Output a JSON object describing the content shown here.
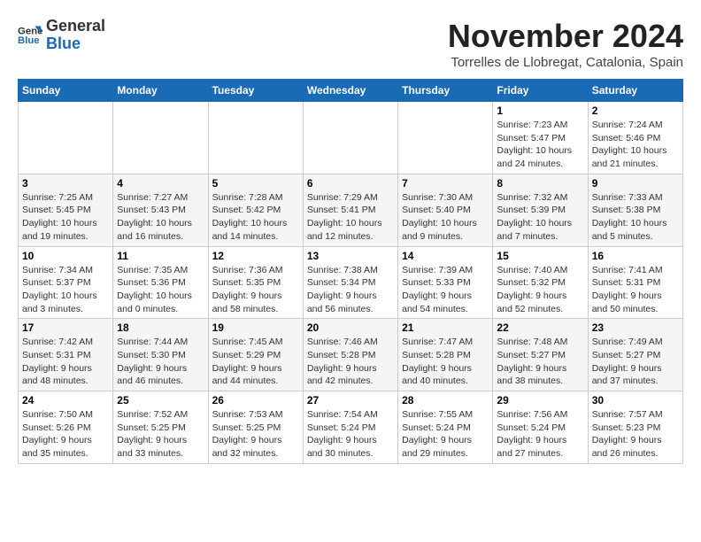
{
  "logo": {
    "general": "General",
    "blue": "Blue"
  },
  "header": {
    "month_title": "November 2024",
    "location": "Torrelles de Llobregat, Catalonia, Spain"
  },
  "weekdays": [
    "Sunday",
    "Monday",
    "Tuesday",
    "Wednesday",
    "Thursday",
    "Friday",
    "Saturday"
  ],
  "weeks": [
    [
      {
        "day": "",
        "info": ""
      },
      {
        "day": "",
        "info": ""
      },
      {
        "day": "",
        "info": ""
      },
      {
        "day": "",
        "info": ""
      },
      {
        "day": "",
        "info": ""
      },
      {
        "day": "1",
        "info": "Sunrise: 7:23 AM\nSunset: 5:47 PM\nDaylight: 10 hours and 24 minutes."
      },
      {
        "day": "2",
        "info": "Sunrise: 7:24 AM\nSunset: 5:46 PM\nDaylight: 10 hours and 21 minutes."
      }
    ],
    [
      {
        "day": "3",
        "info": "Sunrise: 7:25 AM\nSunset: 5:45 PM\nDaylight: 10 hours and 19 minutes."
      },
      {
        "day": "4",
        "info": "Sunrise: 7:27 AM\nSunset: 5:43 PM\nDaylight: 10 hours and 16 minutes."
      },
      {
        "day": "5",
        "info": "Sunrise: 7:28 AM\nSunset: 5:42 PM\nDaylight: 10 hours and 14 minutes."
      },
      {
        "day": "6",
        "info": "Sunrise: 7:29 AM\nSunset: 5:41 PM\nDaylight: 10 hours and 12 minutes."
      },
      {
        "day": "7",
        "info": "Sunrise: 7:30 AM\nSunset: 5:40 PM\nDaylight: 10 hours and 9 minutes."
      },
      {
        "day": "8",
        "info": "Sunrise: 7:32 AM\nSunset: 5:39 PM\nDaylight: 10 hours and 7 minutes."
      },
      {
        "day": "9",
        "info": "Sunrise: 7:33 AM\nSunset: 5:38 PM\nDaylight: 10 hours and 5 minutes."
      }
    ],
    [
      {
        "day": "10",
        "info": "Sunrise: 7:34 AM\nSunset: 5:37 PM\nDaylight: 10 hours and 3 minutes."
      },
      {
        "day": "11",
        "info": "Sunrise: 7:35 AM\nSunset: 5:36 PM\nDaylight: 10 hours and 0 minutes."
      },
      {
        "day": "12",
        "info": "Sunrise: 7:36 AM\nSunset: 5:35 PM\nDaylight: 9 hours and 58 minutes."
      },
      {
        "day": "13",
        "info": "Sunrise: 7:38 AM\nSunset: 5:34 PM\nDaylight: 9 hours and 56 minutes."
      },
      {
        "day": "14",
        "info": "Sunrise: 7:39 AM\nSunset: 5:33 PM\nDaylight: 9 hours and 54 minutes."
      },
      {
        "day": "15",
        "info": "Sunrise: 7:40 AM\nSunset: 5:32 PM\nDaylight: 9 hours and 52 minutes."
      },
      {
        "day": "16",
        "info": "Sunrise: 7:41 AM\nSunset: 5:31 PM\nDaylight: 9 hours and 50 minutes."
      }
    ],
    [
      {
        "day": "17",
        "info": "Sunrise: 7:42 AM\nSunset: 5:31 PM\nDaylight: 9 hours and 48 minutes."
      },
      {
        "day": "18",
        "info": "Sunrise: 7:44 AM\nSunset: 5:30 PM\nDaylight: 9 hours and 46 minutes."
      },
      {
        "day": "19",
        "info": "Sunrise: 7:45 AM\nSunset: 5:29 PM\nDaylight: 9 hours and 44 minutes."
      },
      {
        "day": "20",
        "info": "Sunrise: 7:46 AM\nSunset: 5:28 PM\nDaylight: 9 hours and 42 minutes."
      },
      {
        "day": "21",
        "info": "Sunrise: 7:47 AM\nSunset: 5:28 PM\nDaylight: 9 hours and 40 minutes."
      },
      {
        "day": "22",
        "info": "Sunrise: 7:48 AM\nSunset: 5:27 PM\nDaylight: 9 hours and 38 minutes."
      },
      {
        "day": "23",
        "info": "Sunrise: 7:49 AM\nSunset: 5:27 PM\nDaylight: 9 hours and 37 minutes."
      }
    ],
    [
      {
        "day": "24",
        "info": "Sunrise: 7:50 AM\nSunset: 5:26 PM\nDaylight: 9 hours and 35 minutes."
      },
      {
        "day": "25",
        "info": "Sunrise: 7:52 AM\nSunset: 5:25 PM\nDaylight: 9 hours and 33 minutes."
      },
      {
        "day": "26",
        "info": "Sunrise: 7:53 AM\nSunset: 5:25 PM\nDaylight: 9 hours and 32 minutes."
      },
      {
        "day": "27",
        "info": "Sunrise: 7:54 AM\nSunset: 5:24 PM\nDaylight: 9 hours and 30 minutes."
      },
      {
        "day": "28",
        "info": "Sunrise: 7:55 AM\nSunset: 5:24 PM\nDaylight: 9 hours and 29 minutes."
      },
      {
        "day": "29",
        "info": "Sunrise: 7:56 AM\nSunset: 5:24 PM\nDaylight: 9 hours and 27 minutes."
      },
      {
        "day": "30",
        "info": "Sunrise: 7:57 AM\nSunset: 5:23 PM\nDaylight: 9 hours and 26 minutes."
      }
    ]
  ]
}
